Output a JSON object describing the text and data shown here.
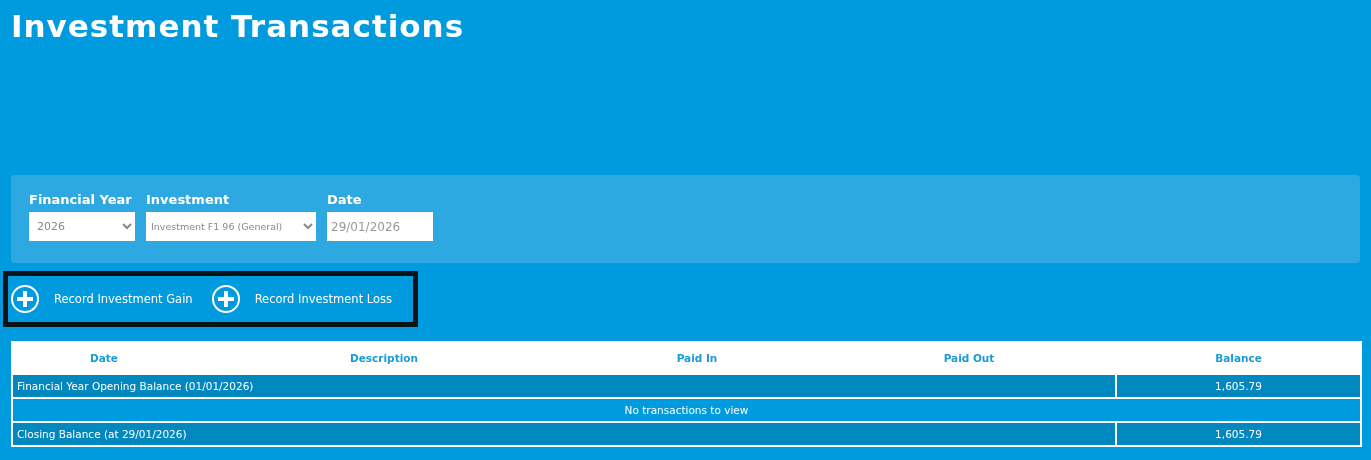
{
  "page": {
    "title": "Investment Transactions"
  },
  "filters": [
    {
      "kind": "select",
      "label": "Financial Year",
      "value": "2026"
    },
    {
      "kind": "select",
      "label": "Investment",
      "value": "Investment F1 96 (General)"
    },
    {
      "kind": "date",
      "label": "Date",
      "value": "29/01/2026"
    }
  ],
  "actions": [
    "Record Investment Gain",
    "Record Investment Loss"
  ],
  "table": {
    "columns": [
      "Date",
      "Description",
      "Paid In",
      "Paid Out",
      "Balance"
    ],
    "rows": [
      {
        "kind": "balance",
        "label": "Financial Year Opening Balance (01/01/2026)",
        "balance": "1,605.79"
      },
      {
        "kind": "empty",
        "label": "No transactions to view"
      },
      {
        "kind": "balance",
        "label": "Closing Balance (at 29/01/2026)",
        "balance": "1,605.79"
      }
    ]
  }
}
